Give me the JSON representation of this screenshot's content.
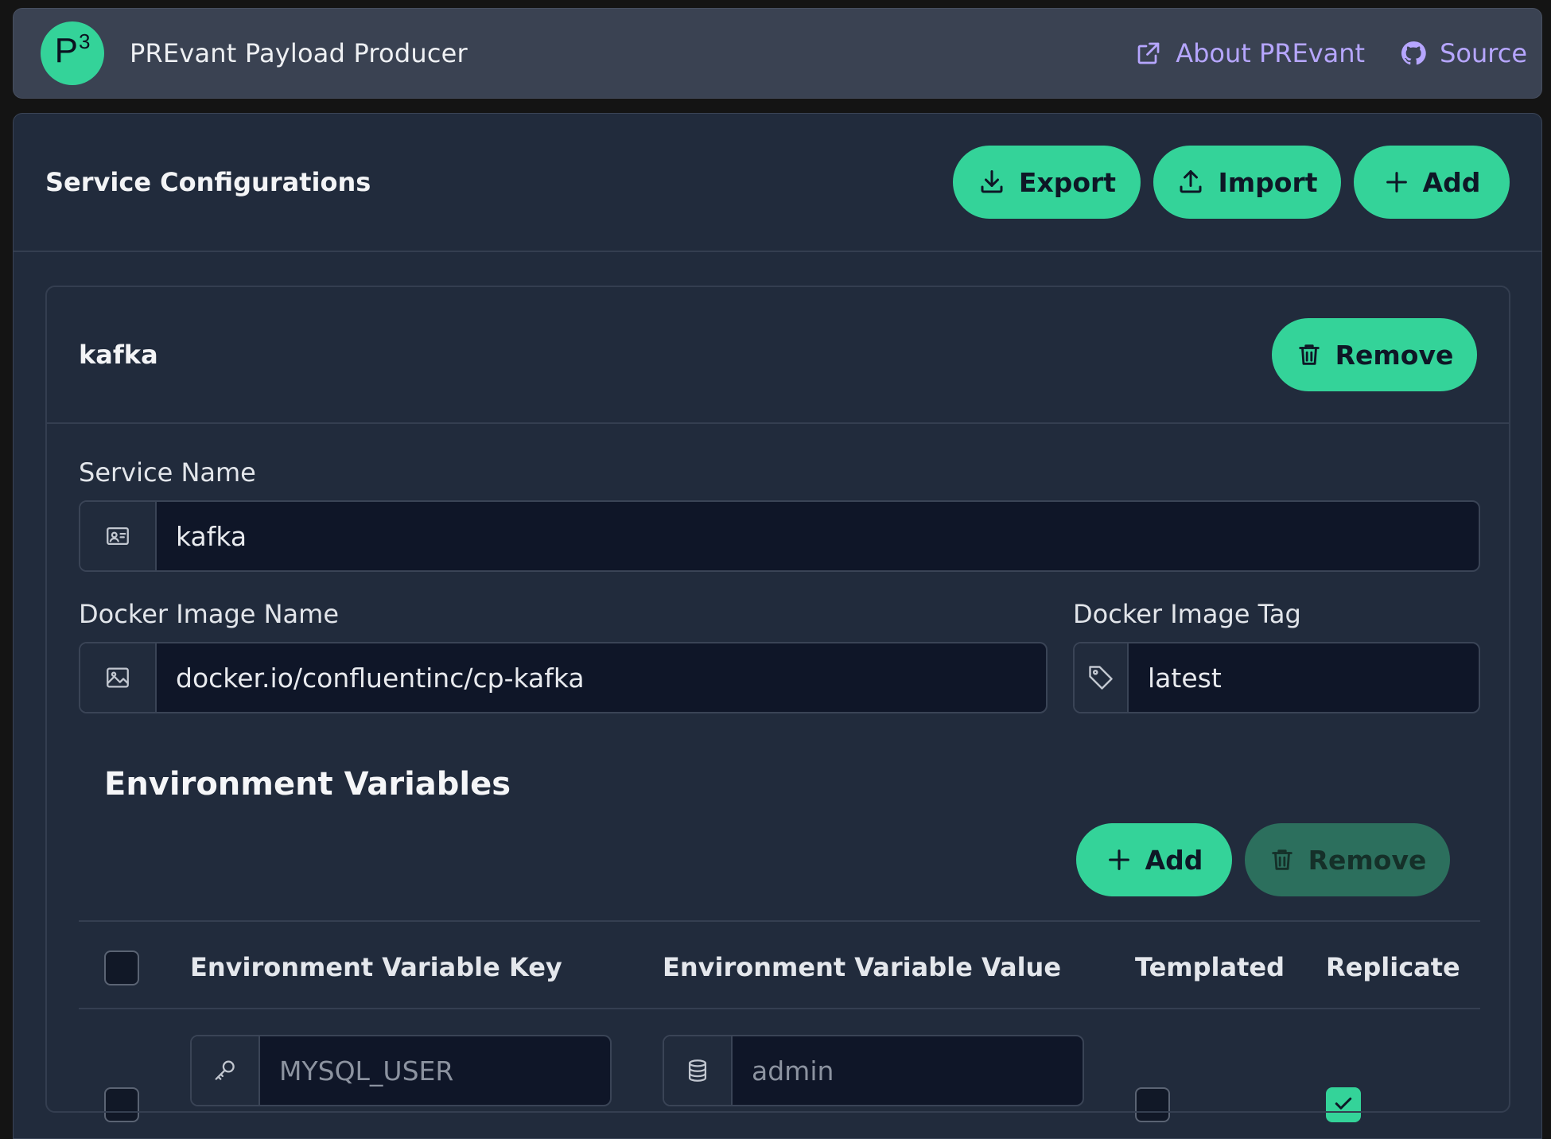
{
  "navbar": {
    "logo_letter": "P",
    "logo_sup": "3",
    "title": "PREvant Payload Producer",
    "links": [
      {
        "label": "About PREvant",
        "icon": "external-link-icon"
      },
      {
        "label": "Source",
        "icon": "github-icon"
      }
    ]
  },
  "main": {
    "title": "Service Configurations",
    "buttons": {
      "export": "Export",
      "import": "Import",
      "add": "Add"
    }
  },
  "service": {
    "title": "kafka",
    "remove_label": "Remove",
    "service_name_label": "Service Name",
    "service_name_value": "kafka",
    "image_name_label": "Docker Image Name",
    "image_name_value": "docker.io/confluentinc/cp-kafka",
    "image_tag_label": "Docker Image Tag",
    "image_tag_value": "latest"
  },
  "env": {
    "title": "Environment Variables",
    "add_label": "Add",
    "remove_label": "Remove",
    "remove_disabled": true,
    "columns": {
      "key": "Environment Variable Key",
      "value": "Environment Variable Value",
      "templated": "Templated",
      "replicate": "Replicate"
    },
    "rows": [
      {
        "key_placeholder": "MYSQL_USER",
        "value_placeholder": "admin",
        "selected": false,
        "templated": false,
        "replicate": true
      }
    ]
  },
  "colors": {
    "accent": "#34d399",
    "link": "#b6a6ff",
    "navbar": "#3a4252",
    "panel": "#212b3c",
    "input_bg": "#0f1628"
  }
}
